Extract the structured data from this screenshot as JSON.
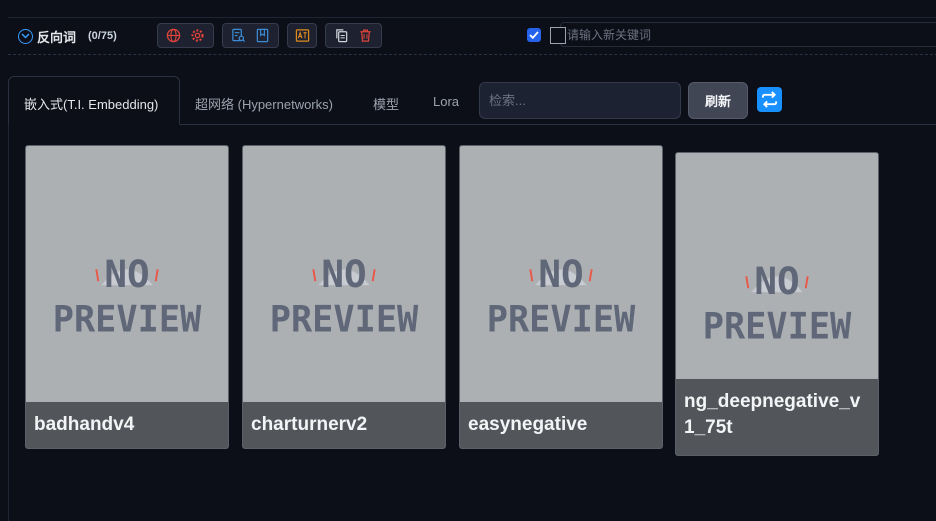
{
  "prompt_section": {
    "title": "反向词",
    "token_count": "(0/75)",
    "keyword_placeholder": "请输入新关键词",
    "tool_groups": [
      {
        "icons": [
          "globe-icon",
          "gear-icon"
        ],
        "color": "#e0443a"
      },
      {
        "icons": [
          "document-search-icon",
          "bookmark-icon"
        ],
        "color": "#3b8dd8"
      },
      {
        "icons": [
          "translate-icon"
        ],
        "color": "#e08a1e"
      },
      {
        "icons": [
          "copy-icon",
          "trash-icon"
        ],
        "color": "#e0443a"
      }
    ]
  },
  "extra_networks": {
    "tabs": [
      {
        "label": "嵌入式(T.I. Embedding)",
        "active": true
      },
      {
        "label": "超网络 (Hypernetworks)",
        "active": false
      },
      {
        "label": "模型",
        "active": false
      },
      {
        "label": "Lora",
        "active": false
      }
    ],
    "search_placeholder": "检索...",
    "refresh_label": "刷新",
    "cards": [
      {
        "name": "badhandv4",
        "preview_text": [
          "NO",
          "PREVIEW"
        ]
      },
      {
        "name": "charturnerv2",
        "preview_text": [
          "NO",
          "PREVIEW"
        ]
      },
      {
        "name": "easynegative",
        "preview_text": [
          "NO",
          "PREVIEW"
        ]
      },
      {
        "name": "ng_deepnegative_v1_75t",
        "preview_text": [
          "NO",
          "PREVIEW"
        ]
      }
    ]
  },
  "colors": {
    "accent": "#1890ff",
    "checkbox": "#2563eb",
    "card_bg": "#acb0b3",
    "preview_text": "#5f6778"
  }
}
